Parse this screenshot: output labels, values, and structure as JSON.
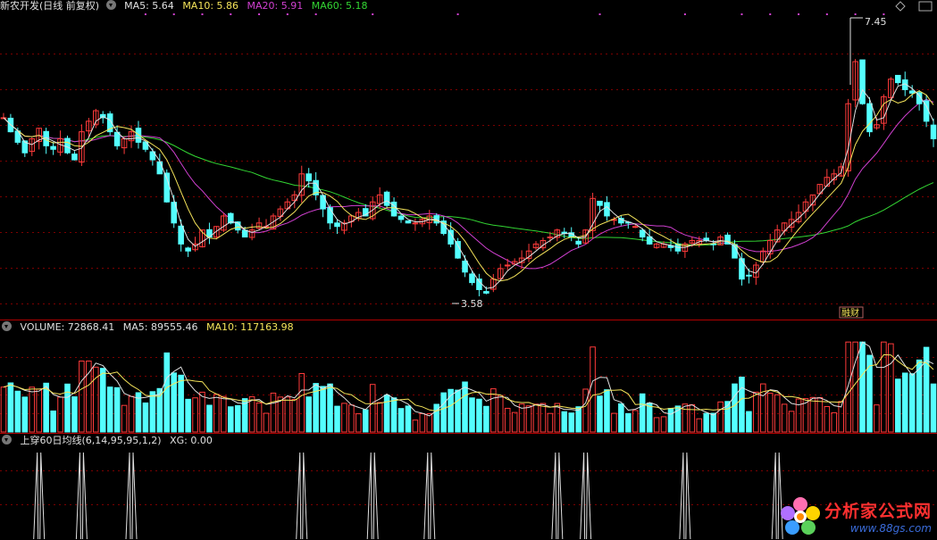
{
  "main_panel": {
    "stock_name": "新农开发(日线 前复权)",
    "ma_labels": [
      {
        "text": "MA5: 5.64",
        "color": "#e0e0e0"
      },
      {
        "text": "MA10: 5.86",
        "color": "#f5e45a"
      },
      {
        "text": "MA20: 5.91",
        "color": "#d040d0"
      },
      {
        "text": "MA60: 5.18",
        "color": "#33d633"
      }
    ],
    "high_label": "7.45",
    "low_label": "3.58",
    "badge": "融财"
  },
  "volume_panel": {
    "labels": [
      {
        "text": "VOLUME: 72868.41",
        "color": "#e0e0e0"
      },
      {
        "text": "MA5: 89555.46",
        "color": "#e0e0e0"
      },
      {
        "text": "MA10: 117163.98",
        "color": "#f5e45a"
      }
    ]
  },
  "indicator_panel": {
    "labels": [
      {
        "text": "上穿60日均线(6,14,95,95,1,2)",
        "color": "#e0e0e0"
      },
      {
        "text": "XG: 0.00",
        "color": "#e0e0e0"
      }
    ]
  },
  "watermark": {
    "title": "分析家公式网",
    "url": "www.88gs.com"
  },
  "colors": {
    "up": "#ff3b3b",
    "down": "#54ffff",
    "ma5": "#e0e0e0",
    "ma10": "#f5e45a",
    "ma20": "#d040d0",
    "ma60": "#33d633",
    "grid": "#7a0000",
    "divider": "#b00000"
  },
  "chart_data": [
    {
      "type": "candlestick",
      "title": "新农开发(日线 前复权)",
      "ylim": [
        3.3,
        7.6
      ],
      "annotations": [
        {
          "label": "7.45",
          "value": 7.45
        },
        {
          "label": "3.58",
          "value": 3.58
        }
      ],
      "series": [
        {
          "name": "MA5",
          "last": 5.64
        },
        {
          "name": "MA10",
          "last": 5.86
        },
        {
          "name": "MA20",
          "last": 5.91
        },
        {
          "name": "MA60",
          "last": 5.18
        }
      ],
      "close_path": [
        6.1,
        5.9,
        5.75,
        5.6,
        5.8,
        5.95,
        5.7,
        5.65,
        5.8,
        5.6,
        5.5,
        5.9,
        6.05,
        6.2,
        6.1,
        5.9,
        5.7,
        5.8,
        5.9,
        5.75,
        5.65,
        5.5,
        5.3,
        4.9,
        4.6,
        4.3,
        4.2,
        4.3,
        4.5,
        4.4,
        4.55,
        4.7,
        4.6,
        4.5,
        4.4,
        4.5,
        4.6,
        4.55,
        4.7,
        4.8,
        4.9,
        5.0,
        5.3,
        5.2,
        5.0,
        4.8,
        4.6,
        4.55,
        4.6,
        4.7,
        4.75,
        4.7,
        4.9,
        5.0,
        4.85,
        4.7,
        4.65,
        4.6,
        4.6,
        4.65,
        4.7,
        4.6,
        4.45,
        4.3,
        4.1,
        3.9,
        3.75,
        3.65,
        3.6,
        3.8,
        3.95,
        4.0,
        4.05,
        4.1,
        4.2,
        4.3,
        4.35,
        4.4,
        4.5,
        4.45,
        4.4,
        4.3,
        4.5,
        4.95,
        4.85,
        4.7,
        4.65,
        4.6,
        4.6,
        4.55,
        4.4,
        4.3,
        4.3,
        4.3,
        4.25,
        4.2,
        4.3,
        4.35,
        4.35,
        4.35,
        4.3,
        4.4,
        4.3,
        4.1,
        3.8,
        3.85,
        4.0,
        4.2,
        4.35,
        4.5,
        4.6,
        4.65,
        4.75,
        4.9,
        5.0,
        5.15,
        5.25,
        5.3,
        5.4,
        6.3,
        6.9,
        6.3,
        5.9,
        6.0,
        6.4,
        6.65,
        6.6,
        6.5,
        6.45,
        6.3,
        6.05,
        5.8
      ]
    },
    {
      "type": "bar",
      "title": "VOLUME",
      "series": [
        {
          "name": "VOLUME",
          "last": 72868.41
        },
        {
          "name": "MA5",
          "last": 89555.46
        },
        {
          "name": "MA10",
          "last": 117163.98
        }
      ]
    },
    {
      "type": "line",
      "title": "上穿60日均线(6,14,95,95,1,2)",
      "series": [
        {
          "name": "XG",
          "last": 0.0
        }
      ]
    }
  ]
}
